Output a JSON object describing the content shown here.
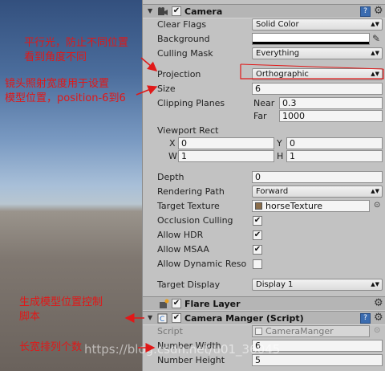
{
  "camera": {
    "title": "Camera",
    "clear_flags": {
      "label": "Clear Flags",
      "value": "Solid Color"
    },
    "background": {
      "label": "Background"
    },
    "culling_mask": {
      "label": "Culling Mask",
      "value": "Everything"
    },
    "projection": {
      "label": "Projection",
      "value": "Orthographic"
    },
    "size": {
      "label": "Size",
      "value": "6"
    },
    "clipping": {
      "label": "Clipping Planes",
      "near_label": "Near",
      "near": "0.3",
      "far_label": "Far",
      "far": "1000"
    },
    "viewport": {
      "label": "Viewport Rect",
      "x_label": "X",
      "x": "0",
      "y_label": "Y",
      "y": "0",
      "w_label": "W",
      "w": "1",
      "h_label": "H",
      "h": "1"
    },
    "depth": {
      "label": "Depth",
      "value": "0"
    },
    "rendering_path": {
      "label": "Rendering Path",
      "value": "Forward"
    },
    "target_texture": {
      "label": "Target Texture",
      "value": "horseTexture"
    },
    "occlusion_culling": {
      "label": "Occlusion Culling",
      "checked": true
    },
    "allow_hdr": {
      "label": "Allow HDR",
      "checked": true
    },
    "allow_msaa": {
      "label": "Allow MSAA",
      "checked": true
    },
    "allow_dynamic": {
      "label": "Allow Dynamic Reso",
      "checked": false
    },
    "target_display": {
      "label": "Target Display",
      "value": "Display 1"
    }
  },
  "flare_layer": {
    "title": "Flare Layer"
  },
  "script_comp": {
    "title": "Camera Manger (Script)",
    "script_label": "Script",
    "script_value": "CameraManger",
    "number_width_label": "Number Width",
    "number_width": "6",
    "number_height_label": "Number Height",
    "number_height": "5"
  },
  "annotations": {
    "a1_line1": "平行光，防止不同位置",
    "a1_line2": "看到角度不同",
    "a2_line1": "镜头照射宽度用于设置",
    "a2_line2": "模型位置，position-6到6",
    "a3_line1": "生成模型位置控制",
    "a3_line2": "脚本",
    "a4": "长宽排列个数"
  },
  "watermark": "https://blog.csdn.net/u01_36045"
}
